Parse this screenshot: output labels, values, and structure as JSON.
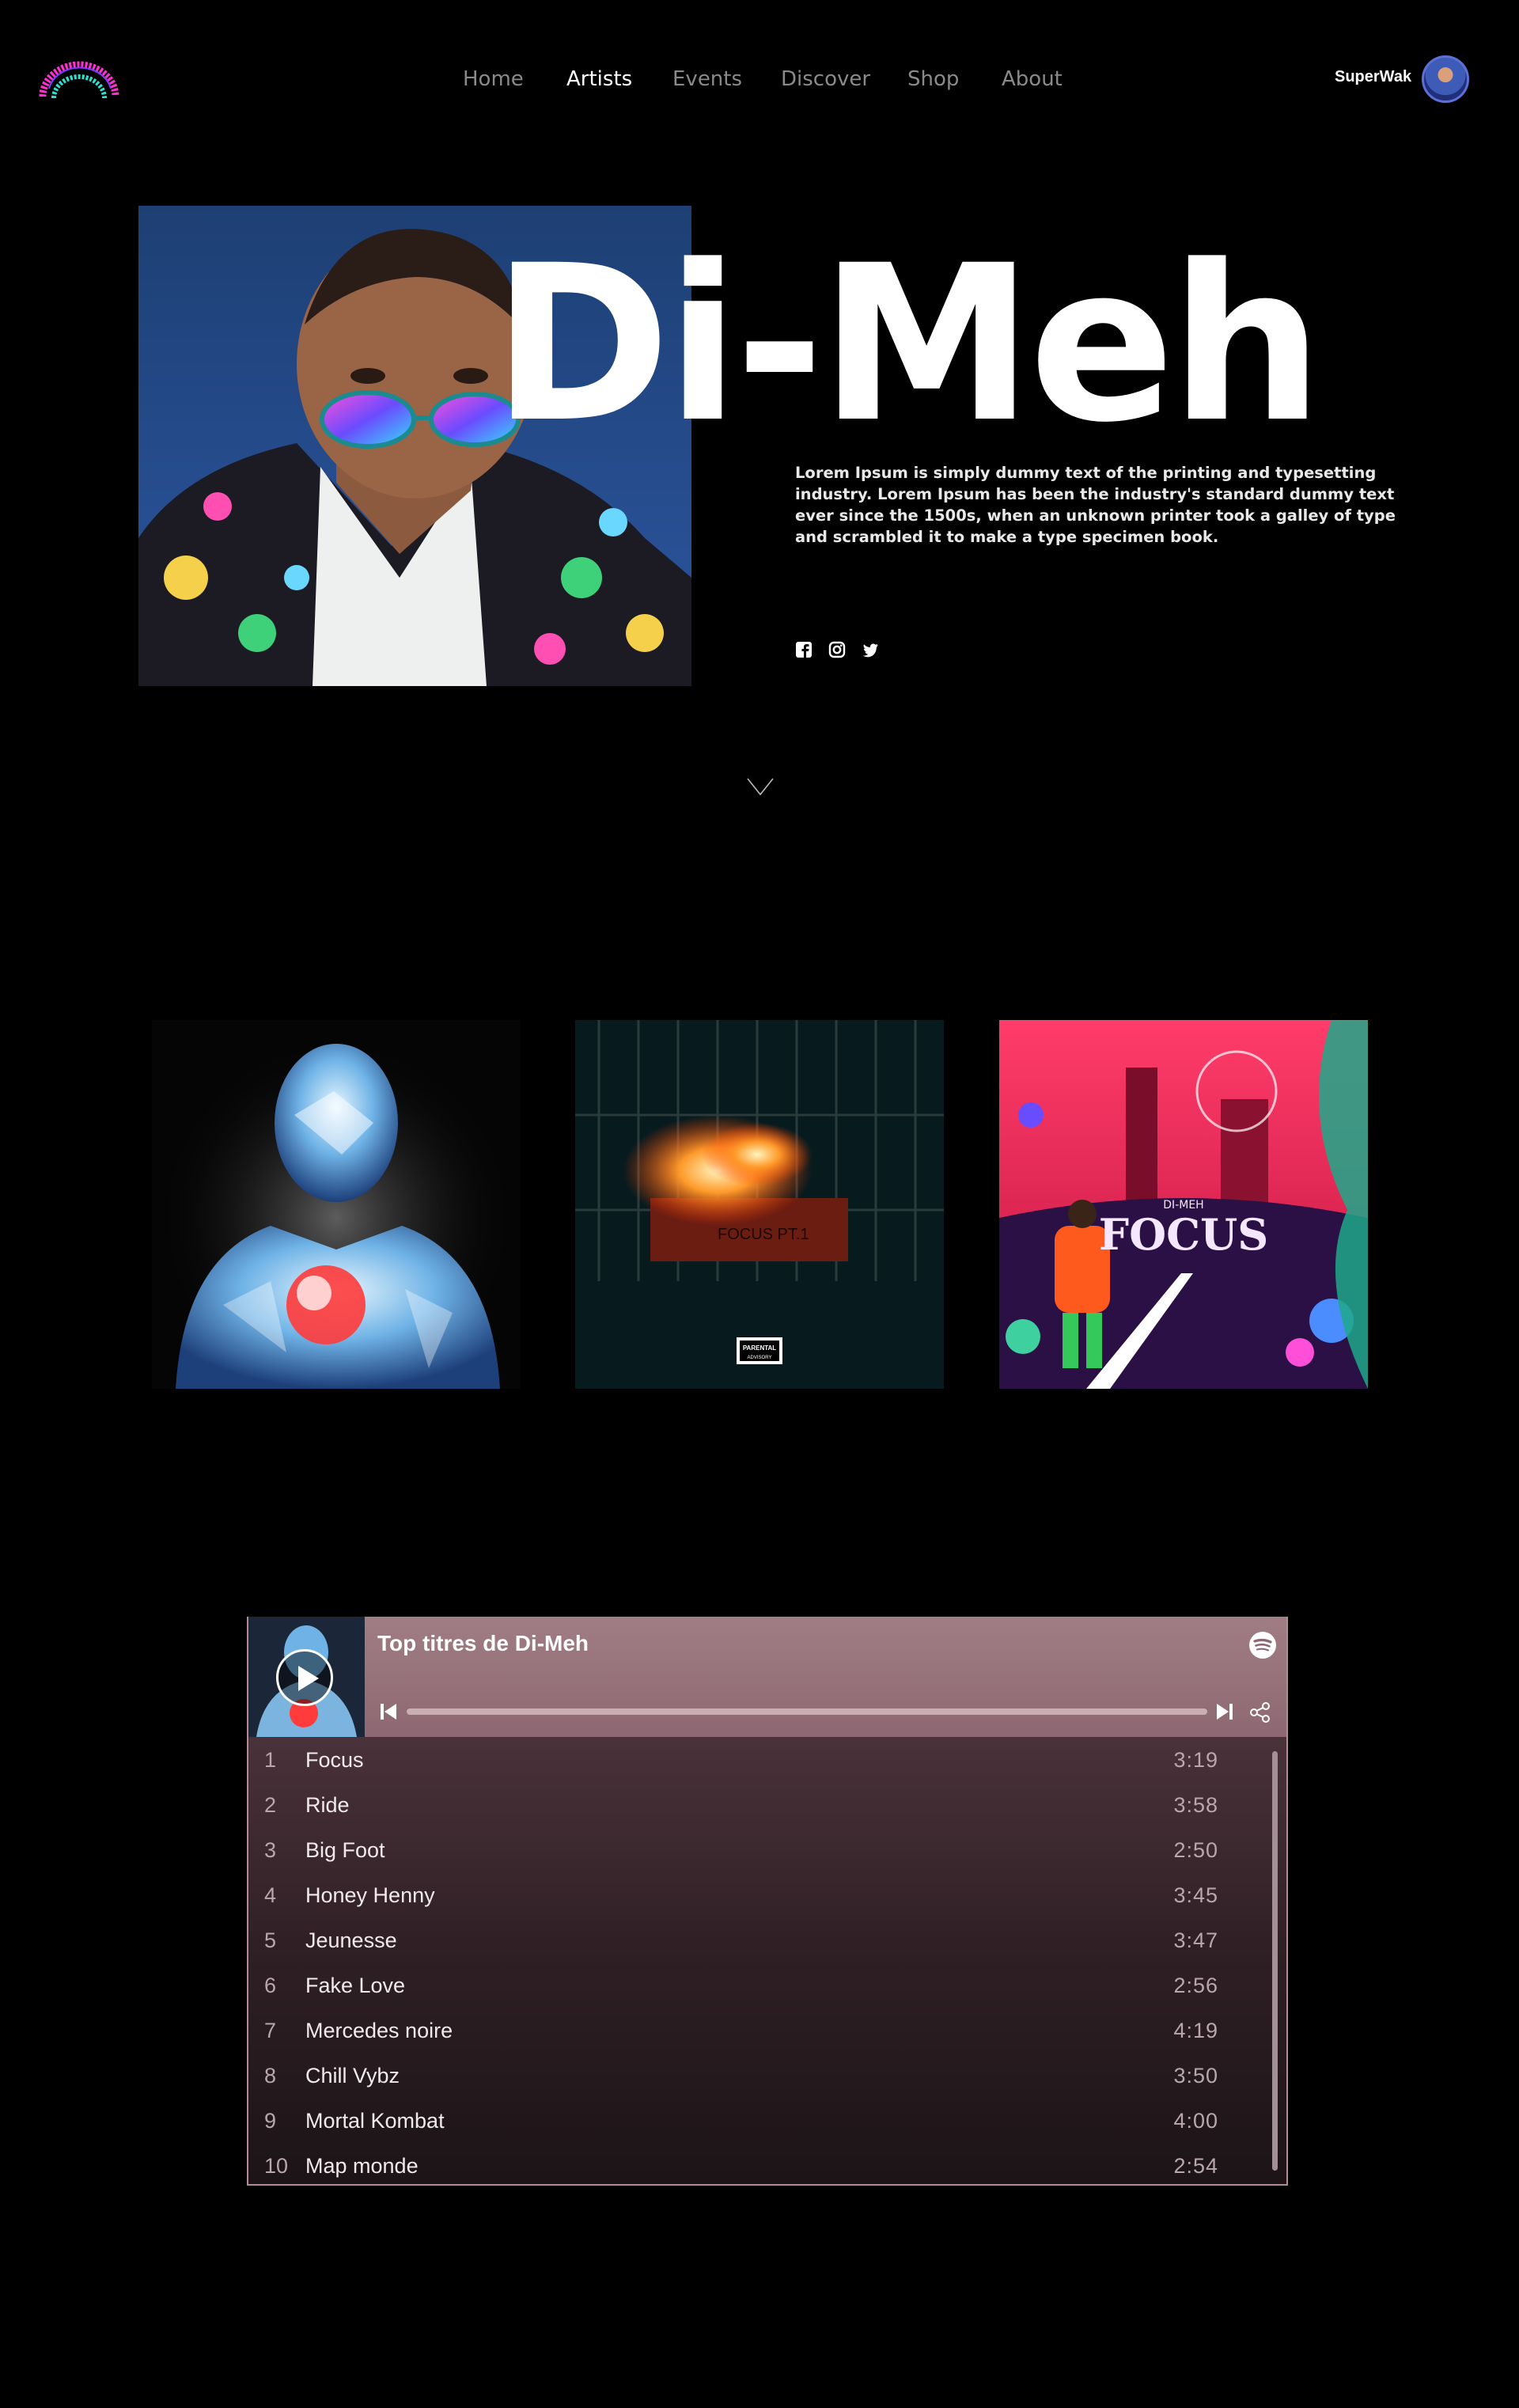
{
  "nav": {
    "items": [
      {
        "label": "Home"
      },
      {
        "label": "Artists",
        "active": true
      },
      {
        "label": "Events"
      },
      {
        "label": "Discover"
      },
      {
        "label": "Shop"
      },
      {
        "label": "About"
      }
    ],
    "user_name": "SuperWak",
    "colors": {
      "logo_pink": "#ff2fd0",
      "logo_teal": "#2fe0d0",
      "active": "#ffffff",
      "inactive": "#8a8a8a"
    }
  },
  "hero": {
    "artist_name": "Di-Meh",
    "description": "Lorem Ipsum is simply dummy text of the printing and typesetting industry. Lorem Ipsum has been the industry's standard dummy text ever since the 1500s, when an unknown printer took a galley of type and scrambled it to make a type specimen book.",
    "socials": [
      "facebook-icon",
      "instagram-icon",
      "twitter-icon"
    ],
    "scroll_icon": "chevron-down-icon"
  },
  "albums": [
    {
      "art": "chrome-figure-cover"
    },
    {
      "art": "burning-car-cover",
      "badge": "PARENTAL ADVISORY EXPLICIT CONTENT",
      "sign_text": "FOCUS PT.1"
    },
    {
      "art": "focus-part2-cover",
      "title_text": "FOCUS",
      "artist_text": "DI-MEH"
    }
  ],
  "player": {
    "title": "Top titres de Di-Meh",
    "progress": 0,
    "icons": [
      "play-icon",
      "spotify-icon",
      "previous-icon",
      "next-icon",
      "share-icon"
    ],
    "tracks": [
      {
        "num": "1",
        "name": "Focus",
        "duration": "3:19"
      },
      {
        "num": "2",
        "name": "Ride",
        "duration": "3:58"
      },
      {
        "num": "3",
        "name": "Big Foot",
        "duration": "2:50"
      },
      {
        "num": "4",
        "name": "Honey Henny",
        "duration": "3:45"
      },
      {
        "num": "5",
        "name": "Jeunesse",
        "duration": "3:47"
      },
      {
        "num": "6",
        "name": "Fake Love",
        "duration": "2:56"
      },
      {
        "num": "7",
        "name": "Mercedes noire",
        "duration": "4:19"
      },
      {
        "num": "8",
        "name": "Chill Vybz",
        "duration": "3:50"
      },
      {
        "num": "9",
        "name": "Mortal Kombat",
        "duration": "4:00"
      },
      {
        "num": "10",
        "name": "Map monde",
        "duration": "2:54"
      }
    ]
  }
}
